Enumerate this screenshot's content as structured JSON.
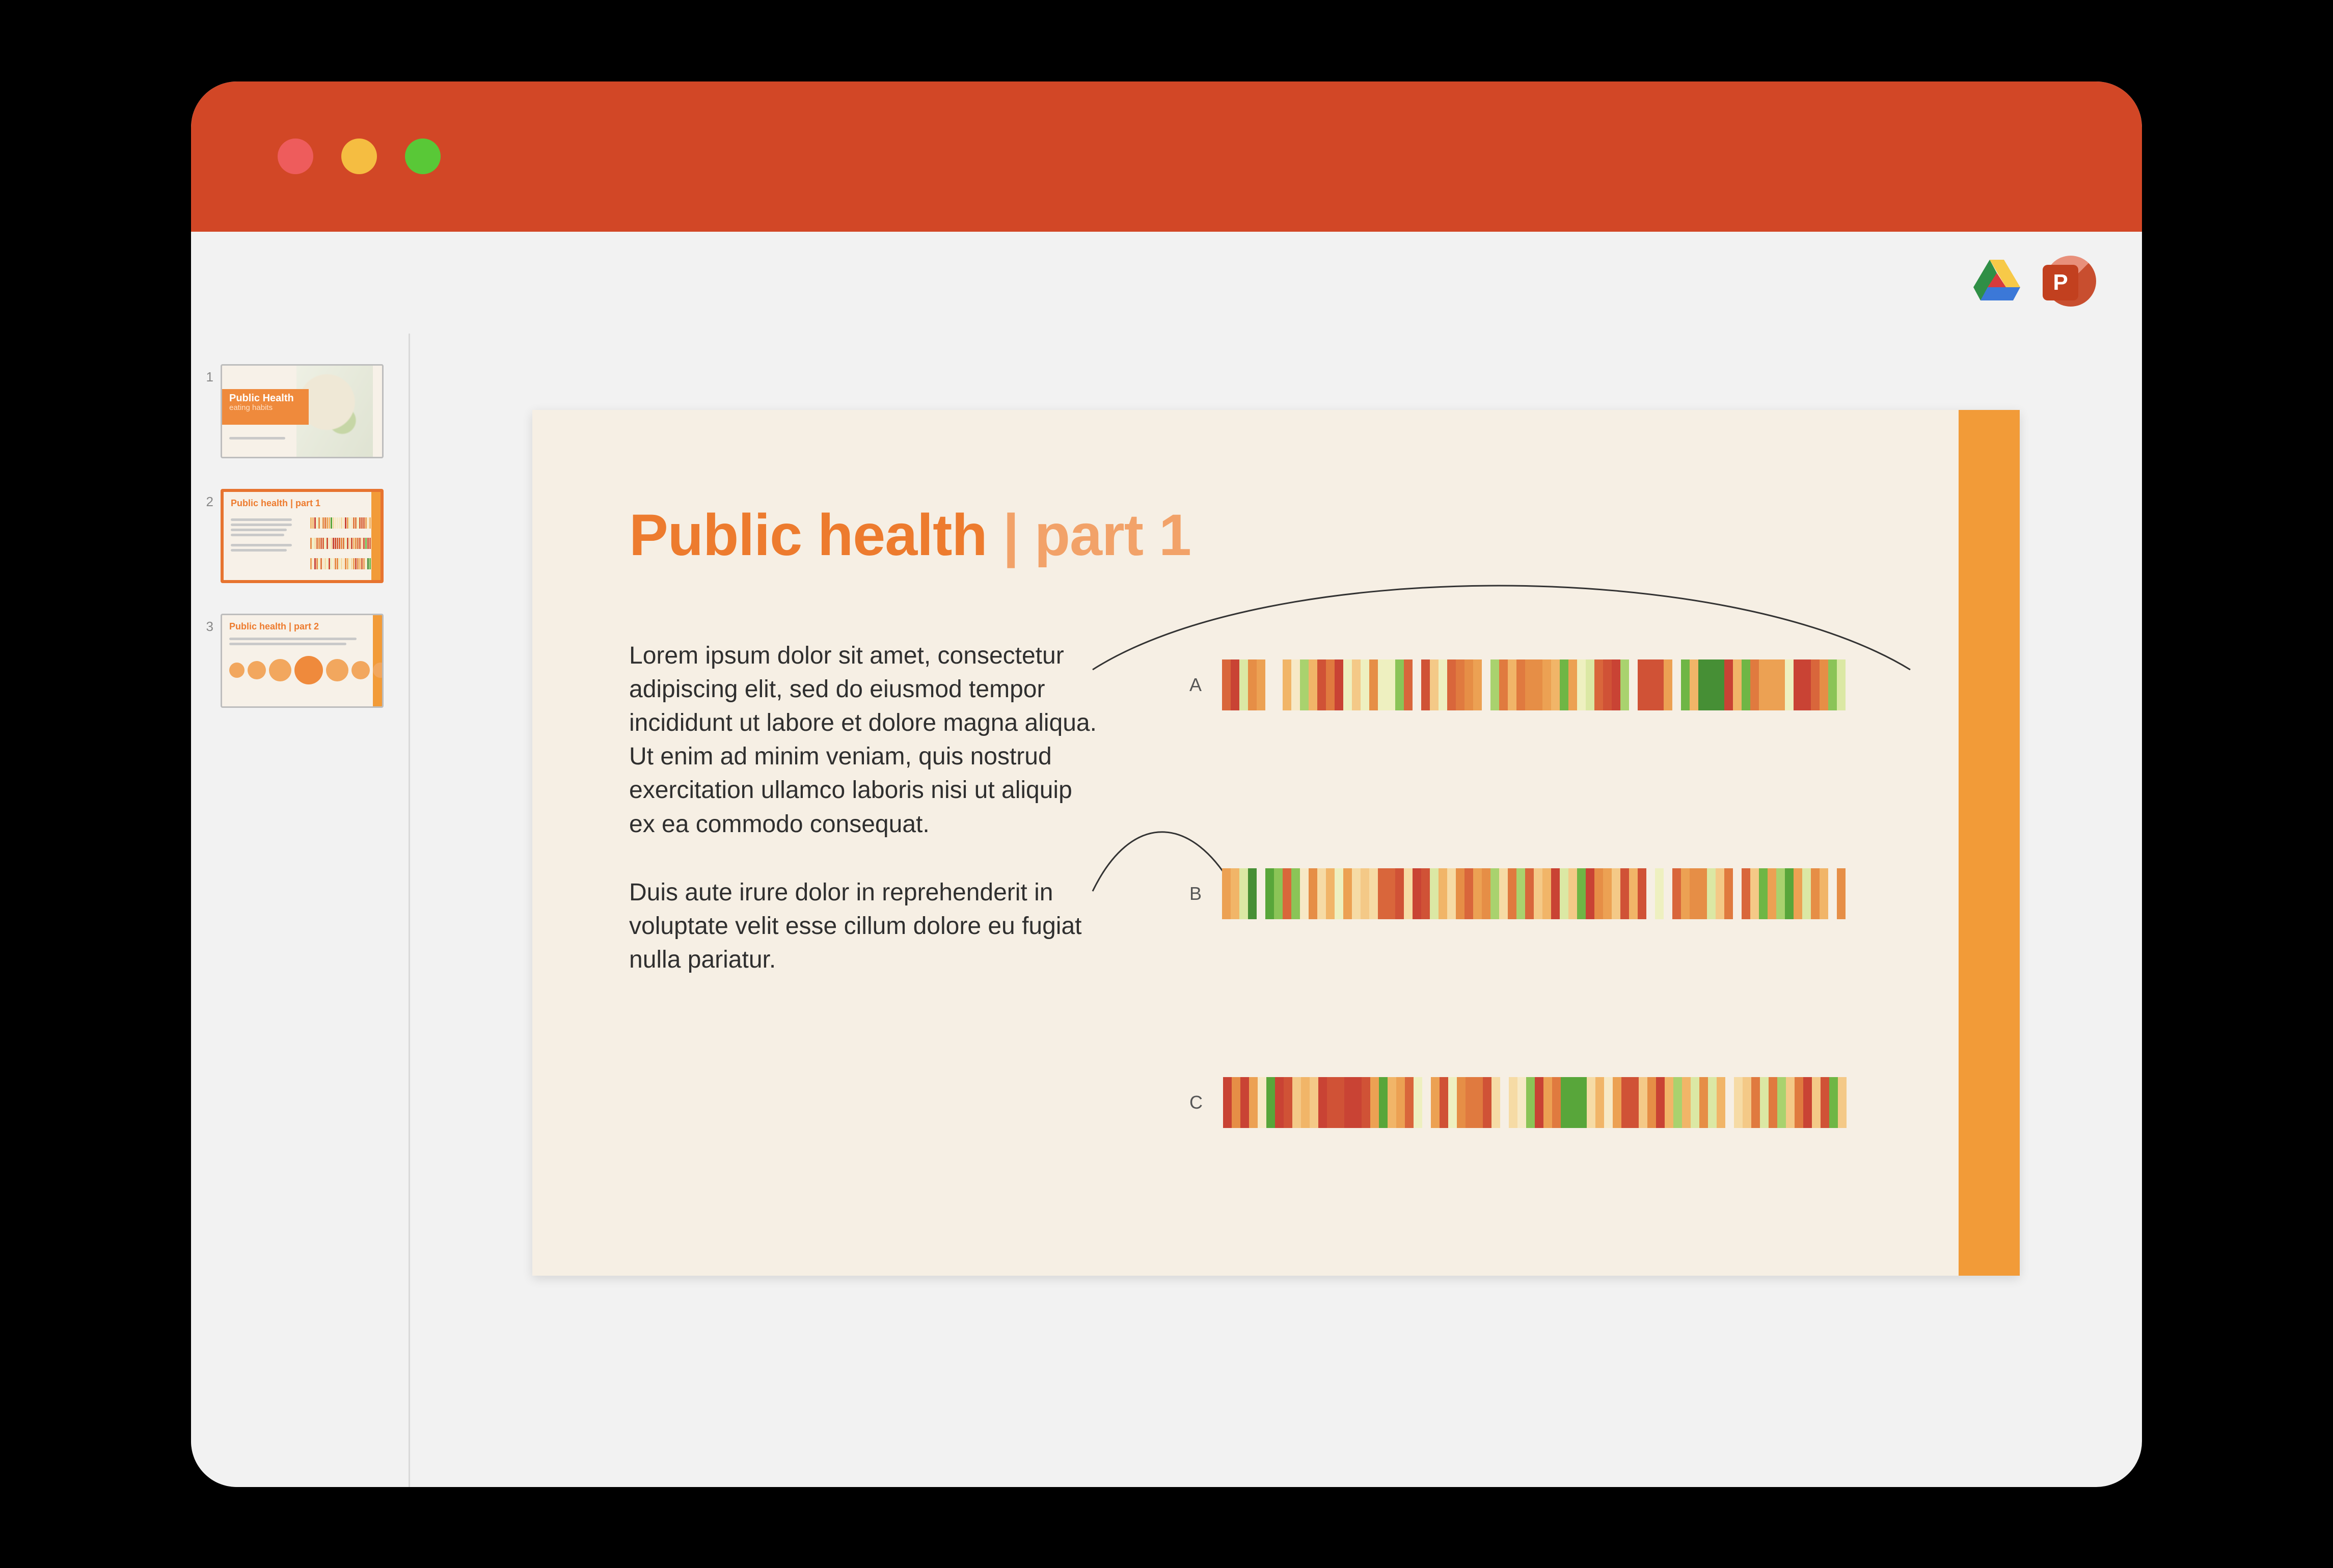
{
  "colors": {
    "accent": "#f29b38",
    "title": "#ed7b2e",
    "titlebar": "#d24726"
  },
  "thumbnails": [
    {
      "num": "1",
      "label": "Public Health",
      "sublabel": "eating habits"
    },
    {
      "num": "2",
      "label": "Public health | part 1"
    },
    {
      "num": "3",
      "label": "Public health | part 2"
    }
  ],
  "slide": {
    "title_bold": "Public health",
    "title_sep": " | ",
    "title_muted": "part 1",
    "para1": "Lorem ipsum dolor sit amet, consectetur adipiscing elit, sed do eiusmod tempor incididunt ut labore et dolore magna aliqua. Ut enim ad minim veniam, quis nostrud exercitation ullamco laboris nisi ut aliquip ex ea commodo consequat.",
    "para2": "Duis aute irure dolor in reprehenderit in voluptate velit esse cillum dolore eu fugiat nulla pariatur.",
    "rows": [
      {
        "label": "A"
      },
      {
        "label": "B"
      },
      {
        "label": "C"
      }
    ]
  },
  "palette": [
    "#c94334",
    "#d05236",
    "#d9663b",
    "#e07a3f",
    "#e68e46",
    "#ecA153",
    "#f1b568",
    "#f4c987",
    "#f6dba5",
    "#f7e9c6",
    "#eef0c0",
    "#dbe8a4",
    "#c4de88",
    "#a9d26e",
    "#8bc457",
    "#6fb645",
    "#58a63a",
    "#468f35"
  ]
}
